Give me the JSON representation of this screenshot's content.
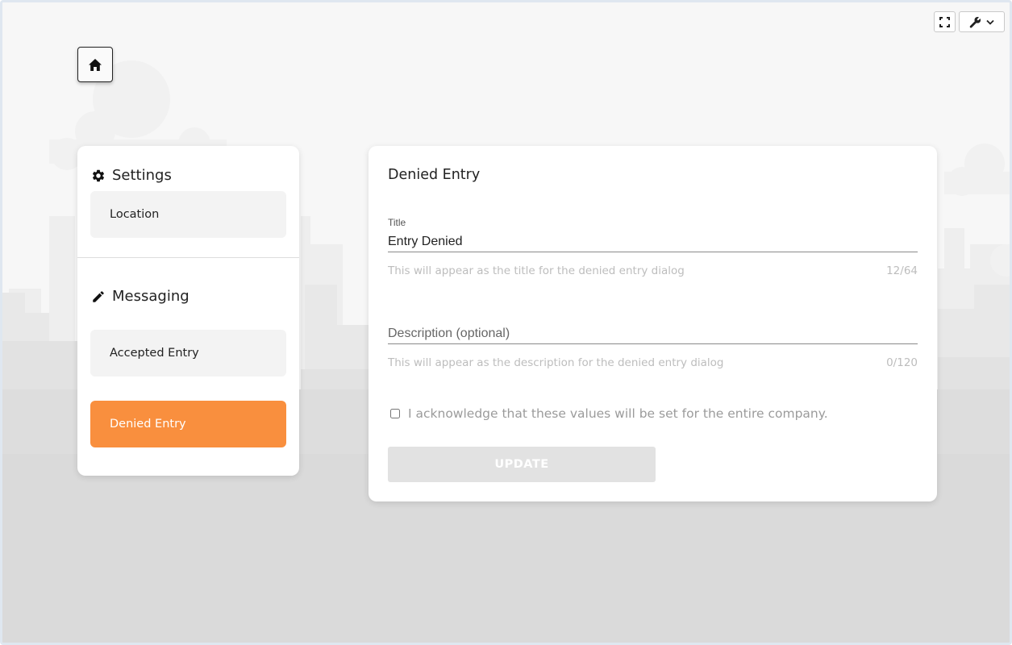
{
  "toolbar": {
    "fullscreen_icon": "fullscreen-icon",
    "wrench_icon": "wrench-icon",
    "dropdown_icon": "chevron-down-icon"
  },
  "home": {
    "icon": "home-icon"
  },
  "sidebar": {
    "settings_heading": "Settings",
    "settings_icon": "gear-icon",
    "location_label": "Location",
    "messaging_heading": "Messaging",
    "messaging_icon": "pencil-icon",
    "items": [
      {
        "label": "Accepted Entry",
        "active": false
      },
      {
        "label": "Denied Entry",
        "active": true
      }
    ]
  },
  "main": {
    "title": "Denied Entry",
    "title_field": {
      "label": "Title",
      "value": "Entry Denied",
      "helper": "This will appear as the title for the denied entry dialog",
      "counter": "12/64"
    },
    "description_field": {
      "placeholder": "Description (optional)",
      "value": "",
      "helper": "This will appear as the description for the denied entry dialog",
      "counter": "0/120"
    },
    "acknowledge_text": "I acknowledge that these values will be set for the entire company.",
    "acknowledge_checked": false,
    "update_label": "UPDATE"
  },
  "colors": {
    "accent": "#f98f3e",
    "background": "#ebebeb",
    "card": "#ffffff",
    "button_disabled": "#e2e2e2"
  }
}
